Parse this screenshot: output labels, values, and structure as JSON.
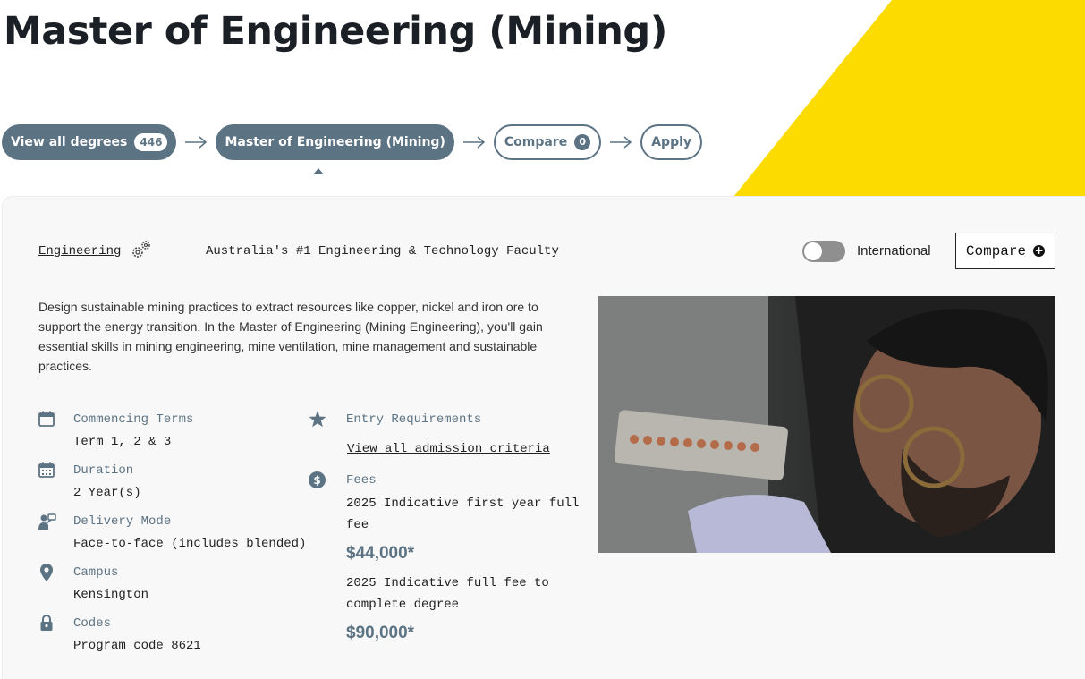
{
  "page": {
    "title": "Master of Engineering (Mining)"
  },
  "breadcrumb": {
    "view_all": {
      "label": "View all degrees",
      "count": "446"
    },
    "current": {
      "label": "Master of Engineering (Mining)"
    },
    "compare": {
      "label": "Compare",
      "count": "0"
    },
    "apply": {
      "label": "Apply"
    }
  },
  "header": {
    "faculty_link": "Engineering",
    "faculty_tagline": "Australia's #1 Engineering & Technology Faculty",
    "toggle_label": "International",
    "toggle_state": "off",
    "compare_button": "Compare"
  },
  "description": "Design sustainable mining practices to extract resources like copper, nickel and iron ore to support the energy transition. In the Master of Engineering (Mining Engineering), you'll gain essential skills in mining engineering, mine ventilation, mine management and sustainable practices.",
  "details": {
    "commencing": {
      "label": "Commencing Terms",
      "value": "Term 1, 2 & 3",
      "icon": "calendar-icon"
    },
    "duration": {
      "label": "Duration",
      "value": "2 Year(s)",
      "icon": "calendar-grid-icon"
    },
    "delivery": {
      "label": "Delivery Mode",
      "value": "Face-to-face (includes blended)",
      "icon": "presenter-icon"
    },
    "campus": {
      "label": "Campus",
      "value": "Kensington",
      "icon": "map-pin-icon"
    },
    "codes": {
      "label": "Codes",
      "value": "Program code 8621",
      "icon": "lock-icon"
    },
    "entry": {
      "label": "Entry Requirements",
      "link": "View all admission criteria",
      "icon": "star-icon"
    },
    "fees": {
      "label": "Fees",
      "icon": "dollar-icon",
      "first_year_text": "2025 Indicative first year full fee",
      "first_year_amount": "$44,000*",
      "full_text": "2025 Indicative full fee to complete degree",
      "full_amount": "$90,000*"
    }
  },
  "colors": {
    "accent": "#5c7384",
    "brand_yellow": "#fcdb00",
    "title": "#1b1f26"
  }
}
